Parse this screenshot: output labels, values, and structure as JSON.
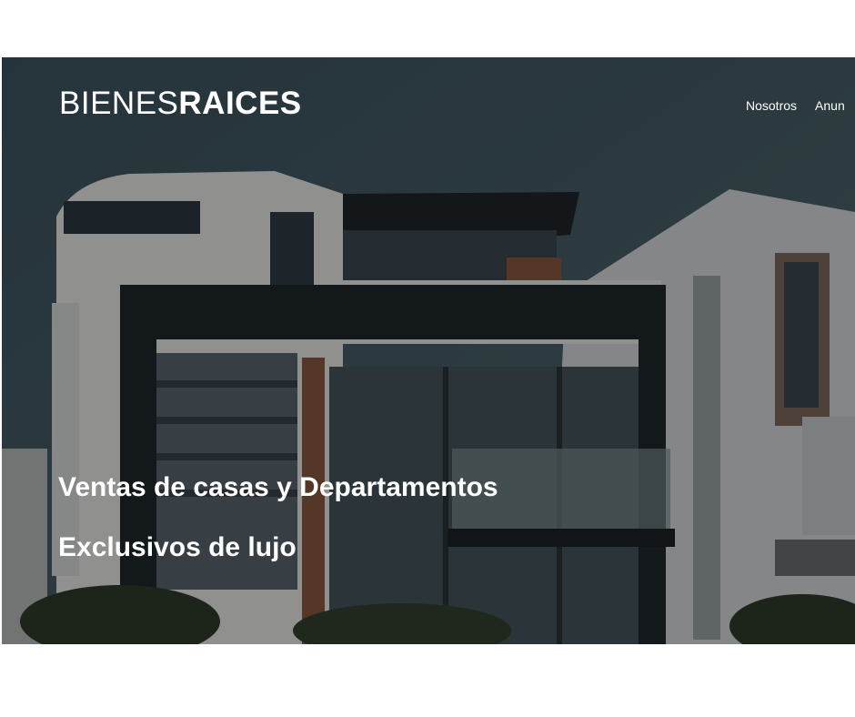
{
  "header": {
    "logo_light": "BIENES",
    "logo_bold": "RAICES",
    "nav": [
      {
        "label": "Nosotros"
      },
      {
        "label": "Anun"
      }
    ]
  },
  "hero": {
    "headline": "Ventas de casas y Departamentos Exclusivos de lujo",
    "overlay_color": "#000000"
  }
}
